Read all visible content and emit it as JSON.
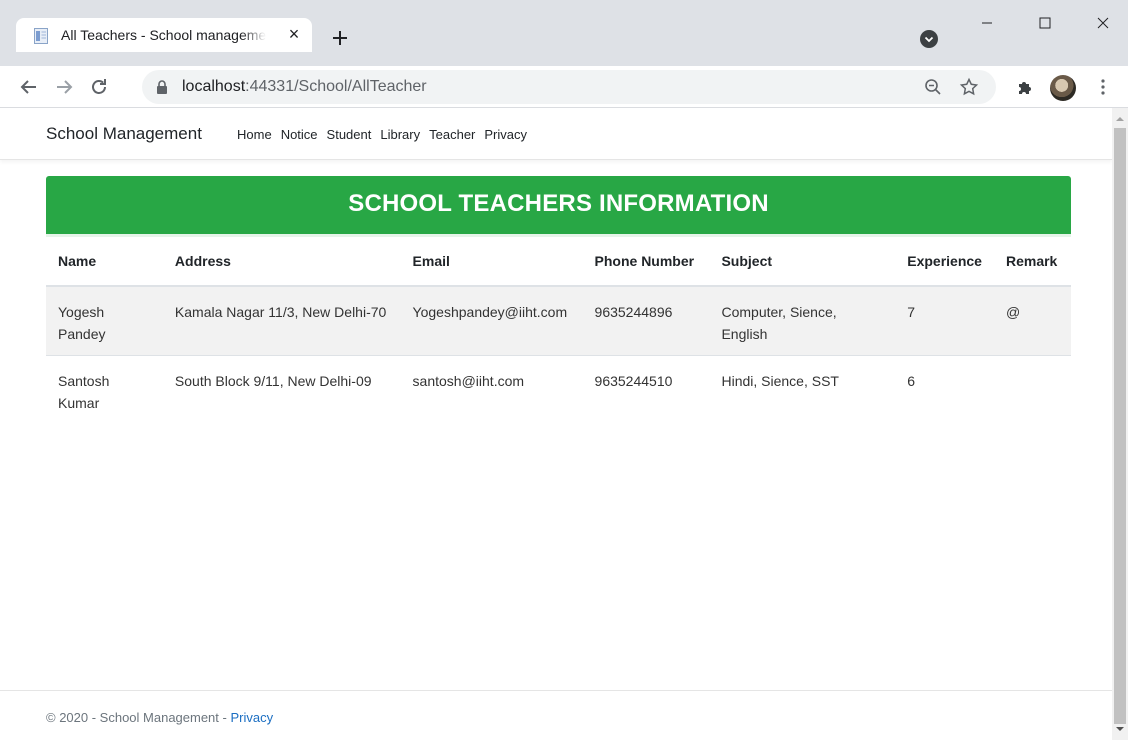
{
  "browser": {
    "tab_title": "All Teachers - School management",
    "tab_close": "×",
    "url_host": "localhost",
    "url_rest": ":44331/School/AllTeacher"
  },
  "site": {
    "brand": "School Management",
    "nav": [
      "Home",
      "Notice",
      "Student",
      "Library",
      "Teacher",
      "Privacy"
    ]
  },
  "banner": {
    "title": "SCHOOL TEACHERS INFORMATION"
  },
  "table": {
    "headers": [
      "Name",
      "Address",
      "Email",
      "Phone Number",
      "Subject",
      "Experience",
      "Remark"
    ],
    "rows": [
      [
        "Yogesh Pandey",
        "Kamala Nagar 11/3, New Delhi-70",
        "Yogeshpandey@iiht.com",
        "9635244896",
        "Computer, Sience, English",
        "7",
        "@"
      ],
      [
        "Santosh Kumar",
        "South Block 9/11, New Delhi-09",
        "santosh@iiht.com",
        "9635244510",
        "Hindi, Sience, SST",
        "6",
        ""
      ]
    ]
  },
  "footer": {
    "text": "© 2020 - School Management - ",
    "link": "Privacy"
  },
  "colors": {
    "banner": "#28a745",
    "link": "#1b6ec2",
    "tabstrip": "#dee1e6"
  },
  "icons": [
    "page-favicon-icon",
    "close-icon",
    "plus-icon",
    "back-arrow-icon",
    "forward-arrow-icon",
    "reload-icon",
    "lock-icon",
    "zoom-icon",
    "star-icon",
    "puzzle-icon",
    "minimize-icon",
    "maximize-icon",
    "window-close-icon"
  ]
}
